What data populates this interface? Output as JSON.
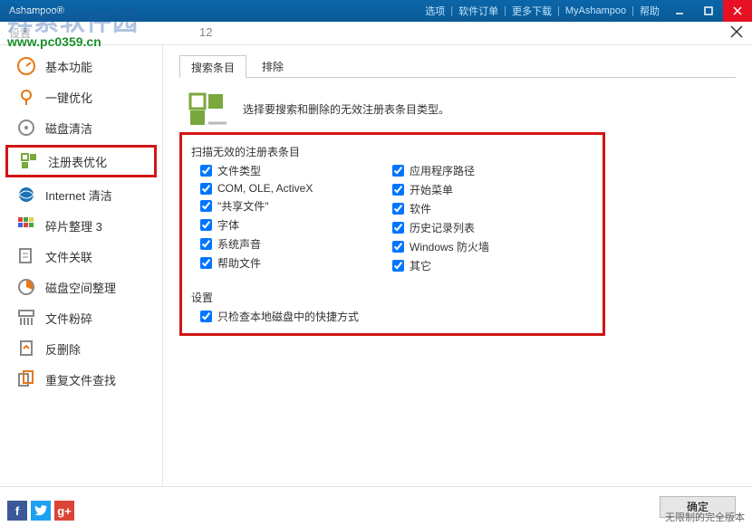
{
  "titlebar": {
    "appname": "Ashampoo®",
    "links": [
      "选项",
      "软件订单",
      "更多下载",
      "MyAshampoo",
      "帮助"
    ]
  },
  "watermark": {
    "cn": "拜索软件园",
    "url": "www.pc0359.cn"
  },
  "header": {
    "breadcrumb": "设置",
    "version_suffix": "12"
  },
  "sidebar": {
    "items": [
      {
        "label": "基本功能",
        "icon": "basic"
      },
      {
        "label": "一键优化",
        "icon": "oneclick"
      },
      {
        "label": "磁盘清洁",
        "icon": "diskclean"
      },
      {
        "label": "注册表优化",
        "icon": "registry",
        "highlight": true
      },
      {
        "label": "Internet 清洁",
        "icon": "internet"
      },
      {
        "label": "碎片整理 3",
        "icon": "defrag"
      },
      {
        "label": "文件关联",
        "icon": "fileassoc"
      },
      {
        "label": "磁盘空间整理",
        "icon": "diskspace"
      },
      {
        "label": "文件粉碎",
        "icon": "shred"
      },
      {
        "label": "反删除",
        "icon": "undelete"
      },
      {
        "label": "重复文件查找",
        "icon": "dupefind"
      }
    ]
  },
  "tabs": {
    "items": [
      "搜索条目",
      "排除"
    ],
    "active": 0
  },
  "description": "选择要搜索和删除的无效注册表条目类型。",
  "group1": {
    "title": "扫描无效的注册表条目",
    "left": [
      {
        "label": "文件类型",
        "checked": true
      },
      {
        "label": "COM, OLE, ActiveX",
        "checked": true
      },
      {
        "label": "\"共享文件\"",
        "checked": true
      },
      {
        "label": "字体",
        "checked": true
      },
      {
        "label": "系统声音",
        "checked": true
      },
      {
        "label": "帮助文件",
        "checked": true
      }
    ],
    "right": [
      {
        "label": "应用程序路径",
        "checked": true
      },
      {
        "label": "开始菜单",
        "checked": true
      },
      {
        "label": "软件",
        "checked": true
      },
      {
        "label": "历史记录列表",
        "checked": true
      },
      {
        "label": "Windows 防火墙",
        "checked": true
      },
      {
        "label": "其它",
        "checked": true
      }
    ]
  },
  "group2": {
    "title": "设置",
    "items": [
      {
        "label": "只检查本地磁盘中的快捷方式",
        "checked": true
      }
    ]
  },
  "footer": {
    "ok": "确定",
    "edition": "无限制的完全版本"
  }
}
